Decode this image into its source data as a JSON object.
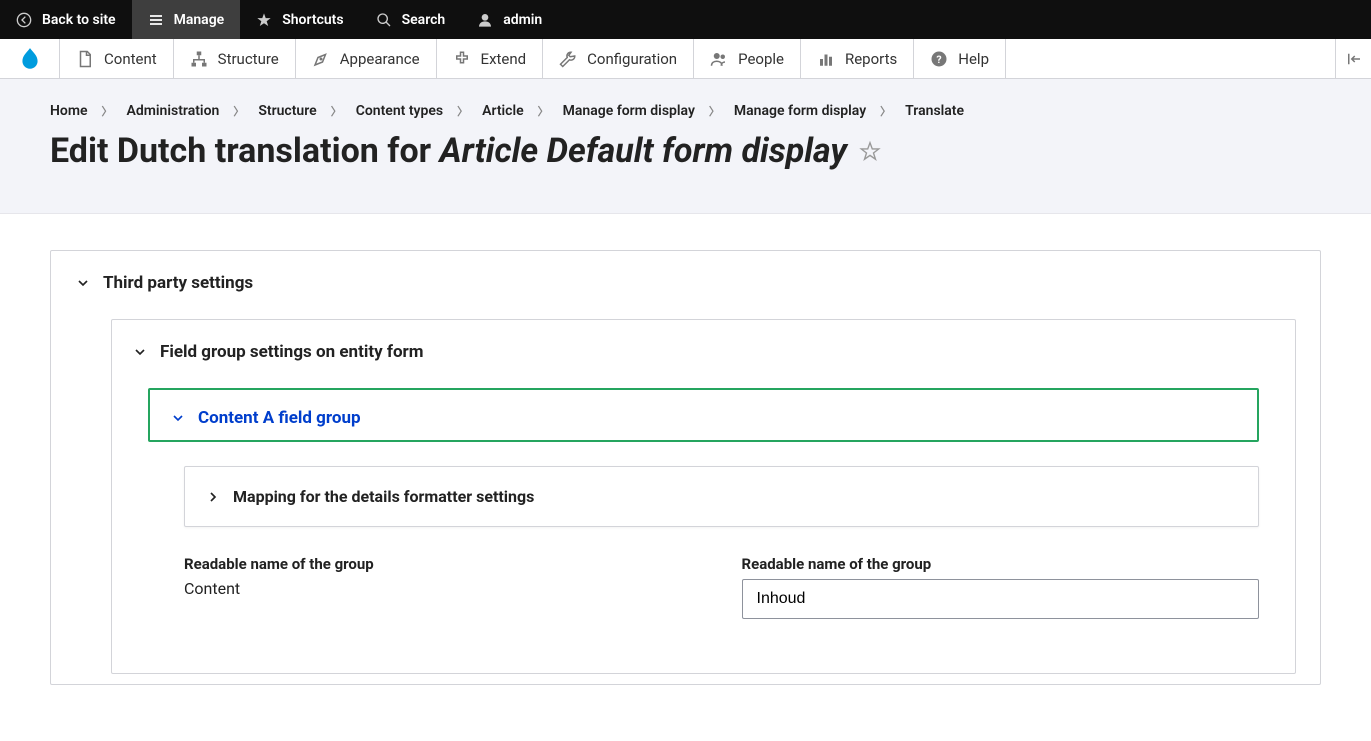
{
  "toolbar": {
    "back": "Back to site",
    "manage": "Manage",
    "shortcuts": "Shortcuts",
    "search": "Search",
    "admin": "admin"
  },
  "admin_tabs": {
    "content": "Content",
    "structure": "Structure",
    "appearance": "Appearance",
    "extend": "Extend",
    "configuration": "Configuration",
    "people": "People",
    "reports": "Reports",
    "help": "Help"
  },
  "breadcrumb": {
    "home": "Home",
    "admin": "Administration",
    "structure": "Structure",
    "types": "Content types",
    "article": "Article",
    "mfd1": "Manage form display",
    "mfd2": "Manage form display",
    "translate": "Translate"
  },
  "title": {
    "prefix": "Edit Dutch translation for ",
    "em": "Article Default form display"
  },
  "details": {
    "third_party": "Third party settings",
    "field_group": "Field group settings on entity form",
    "content_a": "Content A field group",
    "mapping": "Mapping for the details formatter settings",
    "label_source": "Readable name of the group",
    "value_source": "Content",
    "label_target": "Readable name of the group",
    "value_target": "Inhoud"
  }
}
